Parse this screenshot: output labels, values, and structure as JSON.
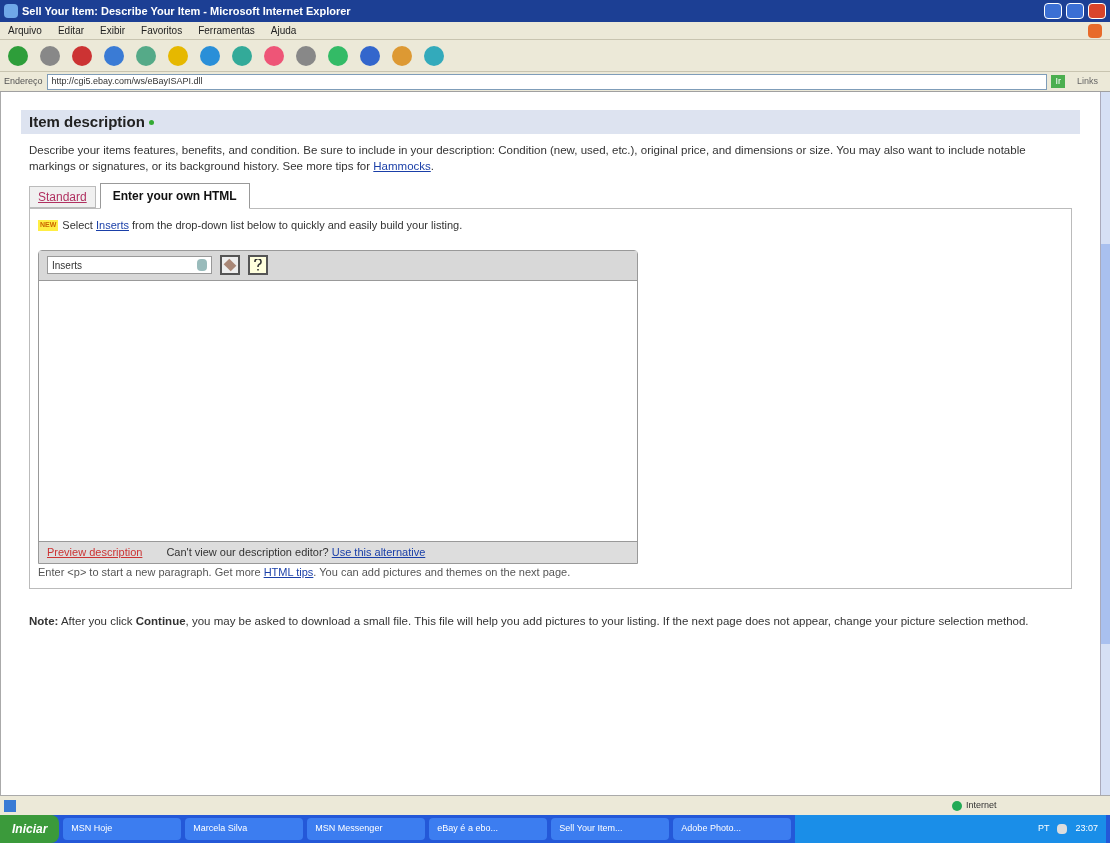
{
  "window": {
    "title": "Sell Your Item: Describe Your Item - Microsoft Internet Explorer"
  },
  "menu": [
    "Arquivo",
    "Editar",
    "Exibir",
    "Favoritos",
    "Ferramentas",
    "Ajuda"
  ],
  "address_bar": {
    "label": "Endereço",
    "url": "http://cgi5.ebay.com/ws/eBayISAPI.dll",
    "go": "Ir",
    "links": "Links"
  },
  "section": {
    "title": "Item description",
    "intro": "Describe your items features, benefits, and condition. Be sure to include in your description: Condition (new, used, etc.), original price, and dimensions or size. You may also want to include notable markings or signatures, or its background history. See more tips for ",
    "intro_link": "Hammocks",
    "intro_end": ".",
    "tabs": [
      {
        "label": "Standard",
        "selected": false
      },
      {
        "label": "Enter your own HTML",
        "selected": true
      }
    ],
    "new_badge": "NEW",
    "hint_before": "Select ",
    "hint_link": "Inserts",
    "hint_after": " from the drop-down list below to quickly and easily build your listing.",
    "inserts_select": "Inserts",
    "preview_link": "Preview description",
    "alt_text": "Can't view our description editor? ",
    "alt_link": "Use this alternative",
    "tip_before": "Enter <p> to start a new paragraph. Get more ",
    "tip_link": "HTML tips",
    "tip_after": ". You can add pictures and themes on the next page."
  },
  "note": {
    "label": "Note:",
    "text": " After you click **Continue**, you may be asked to download a small file. This file will help you add pictures to your listing. If the next page does not appear, change your picture selection method."
  },
  "status_bar": {
    "zone": "Internet"
  },
  "taskbar": {
    "start": "Iniciar",
    "items": [
      "MSN Hoje",
      "Marcela Silva",
      "MSN Messenger",
      "eBay é a ebo...",
      "Sell Your Item...",
      "Adobe Photo..."
    ],
    "lang": "PT",
    "clock": "23:07"
  }
}
